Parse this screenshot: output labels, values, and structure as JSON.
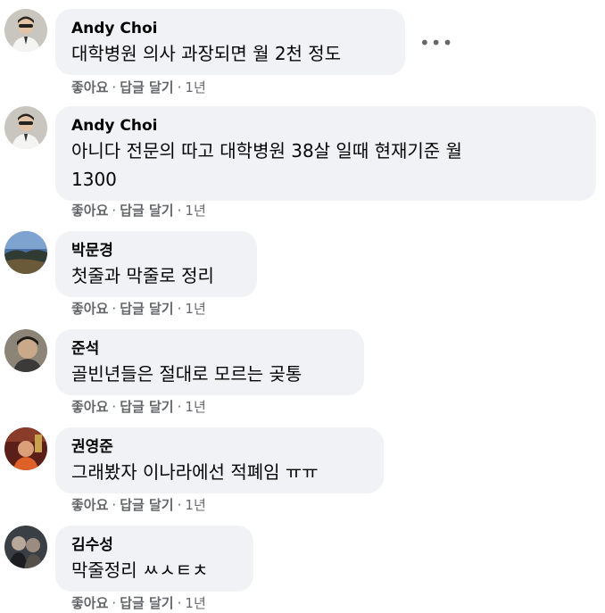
{
  "labels": {
    "like": "좋아요",
    "reply": "답글 달기",
    "separator": "·",
    "more": "•••"
  },
  "comments": [
    {
      "author": "Andy Choi",
      "text": "대학병원 의사 과장되면 월 2천 정도",
      "time": "1년"
    },
    {
      "author": "Andy Choi",
      "text": "아니다 전문의 따고 대학병원 38살 일때 현재기준 월\n1300",
      "time": "1년"
    },
    {
      "author": "박문경",
      "text": "첫줄과 막줄로 정리",
      "time": "1년"
    },
    {
      "author": "준석",
      "text": "골빈년들은 절대로 모르는 곶통",
      "time": "1년"
    },
    {
      "author": "권영준",
      "text": "그래봤자 이나라에선 적폐임 ㅠㅠ",
      "time": "1년"
    },
    {
      "author": "김수성",
      "text": "막줄정리 ㅆㅅㅌㅊ",
      "time": "1년"
    }
  ]
}
